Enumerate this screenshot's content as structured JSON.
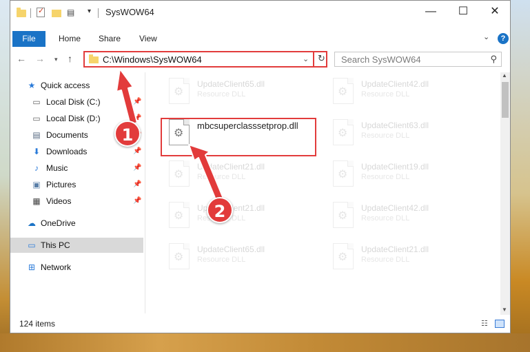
{
  "window": {
    "title": "SysWOW64",
    "minimize_label": "—",
    "maximize_label": "☐",
    "close_label": "✕"
  },
  "ribbon": {
    "file": "File",
    "tabs": [
      "Home",
      "Share",
      "View"
    ],
    "help": "?"
  },
  "navbar": {
    "address": "C:\\Windows\\SysWOW64",
    "search_placeholder": "Search SysWOW64"
  },
  "sidebar": {
    "items": [
      {
        "label": "Quick access",
        "icon": "star-icon",
        "pinned": false
      },
      {
        "label": "Local Disk (C:)",
        "icon": "drive-icon",
        "pinned": true
      },
      {
        "label": "Local Disk (D:)",
        "icon": "drive-icon",
        "pinned": true
      },
      {
        "label": "Documents",
        "icon": "document-icon",
        "pinned": true
      },
      {
        "label": "Downloads",
        "icon": "download-icon",
        "pinned": true
      },
      {
        "label": "Music",
        "icon": "music-icon",
        "pinned": true
      },
      {
        "label": "Pictures",
        "icon": "picture-icon",
        "pinned": true
      },
      {
        "label": "Videos",
        "icon": "video-icon",
        "pinned": true
      },
      {
        "label": "OneDrive",
        "icon": "cloud-icon",
        "pinned": false
      },
      {
        "label": "This PC",
        "icon": "computer-icon",
        "pinned": false,
        "selected": true
      },
      {
        "label": "Network",
        "icon": "network-icon",
        "pinned": false
      }
    ]
  },
  "files": [
    {
      "name": "UpdateClient65.dll",
      "type": "Resource DLL",
      "faded": true
    },
    {
      "name": "UpdateClient42.dll",
      "type": "Resource DLL",
      "faded": true
    },
    {
      "name": "mbcsuperclasssetprop.dll",
      "type": "",
      "faded": false,
      "highlighted": true
    },
    {
      "name": "UpdateClient63.dll",
      "type": "Resource DLL",
      "faded": true
    },
    {
      "name": "UpdateClient21.dll",
      "type": "Resource DLL",
      "faded": true
    },
    {
      "name": "UpdateClient19.dll",
      "type": "Resource DLL",
      "faded": true
    },
    {
      "name": "UpdateClient21.dll",
      "type": "Resource DLL",
      "faded": true
    },
    {
      "name": "UpdateClient42.dll",
      "type": "Resource DLL",
      "faded": true
    },
    {
      "name": "UpdateClient65.dll",
      "type": "Resource DLL",
      "faded": true
    },
    {
      "name": "UpdateClient21.dll",
      "type": "Resource DLL",
      "faded": true
    }
  ],
  "status": {
    "item_count": "124 items"
  },
  "annotations": {
    "step1": "1",
    "step2": "2",
    "color": "#e23b3b"
  }
}
